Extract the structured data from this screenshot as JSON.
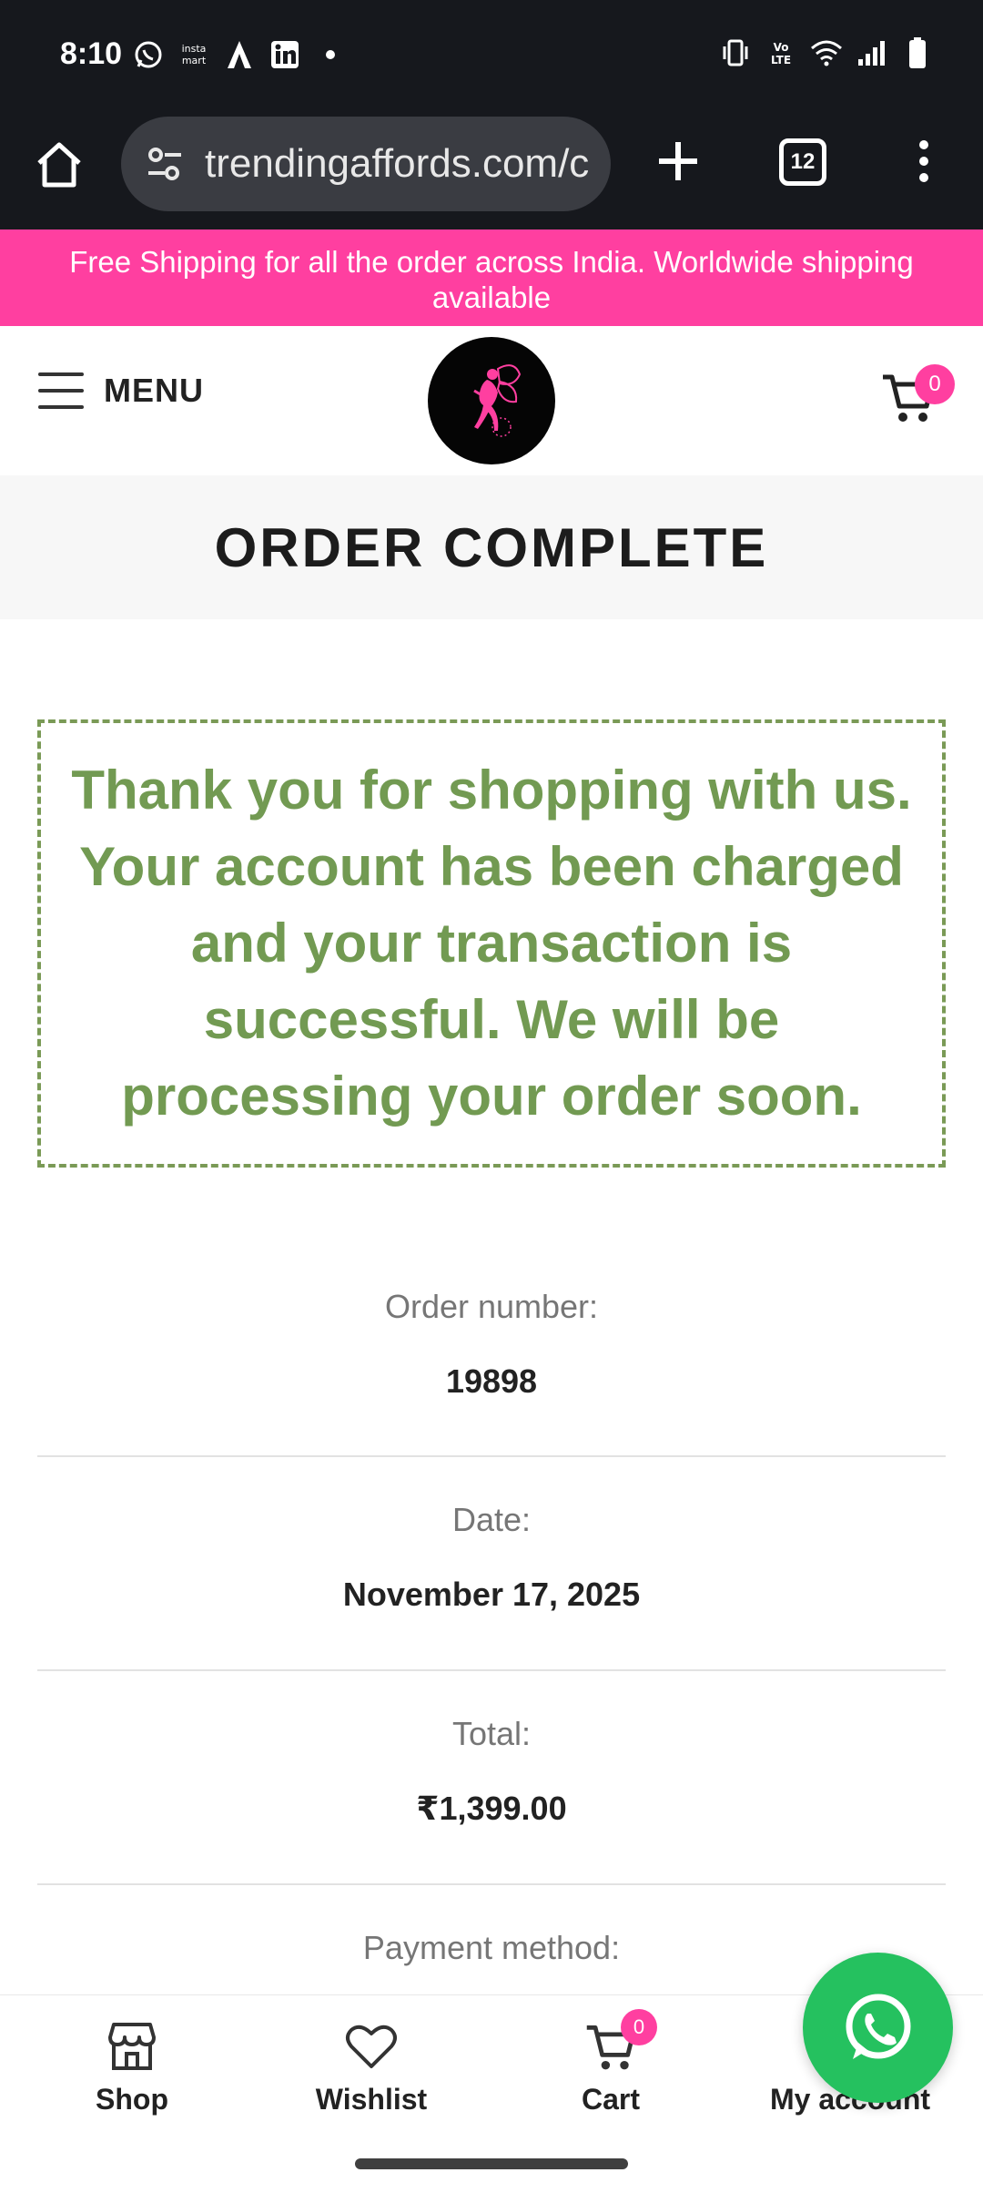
{
  "status_bar": {
    "time": "8:10",
    "app_icons": [
      "whatsapp-icon",
      "instamart-icon",
      "a-app-icon",
      "linkedin-icon",
      "dot-icon"
    ],
    "instamart_text": "insta mart",
    "right_icons": [
      "vibrate-icon",
      "volte-icon",
      "wifi-icon",
      "signal-icon",
      "battery-icon"
    ]
  },
  "browser": {
    "url": "trendingaffords.com/c",
    "tab_count": "12"
  },
  "promo_banner": {
    "text": "Free Shipping for all the order across India. Worldwide shipping available",
    "color": "#ff3fa0"
  },
  "header": {
    "menu_label": "MENU",
    "cart_count": "0"
  },
  "page_title": "ORDER COMPLETE",
  "thank_you_message": "Thank you for shopping with us. Your account has been charged and your transaction is successful. We will be processing your order soon.",
  "order_details": [
    {
      "label": "Order number:",
      "value": "19898"
    },
    {
      "label": "Date:",
      "value": "November 17, 2025"
    },
    {
      "label": "Total:",
      "value": "₹1,399.00"
    },
    {
      "label": "Payment method:",
      "value": ""
    }
  ],
  "bottom_nav": {
    "items": [
      {
        "label": "Shop",
        "icon": "shop-icon"
      },
      {
        "label": "Wishlist",
        "icon": "heart-icon"
      },
      {
        "label": "Cart",
        "icon": "cart-icon"
      },
      {
        "label": "My account",
        "icon": "user-icon"
      }
    ],
    "cart_count": "0"
  },
  "colors": {
    "accent_pink": "#ff3fa0",
    "success_green": "#729a52",
    "whatsapp_green": "#25c15f"
  }
}
